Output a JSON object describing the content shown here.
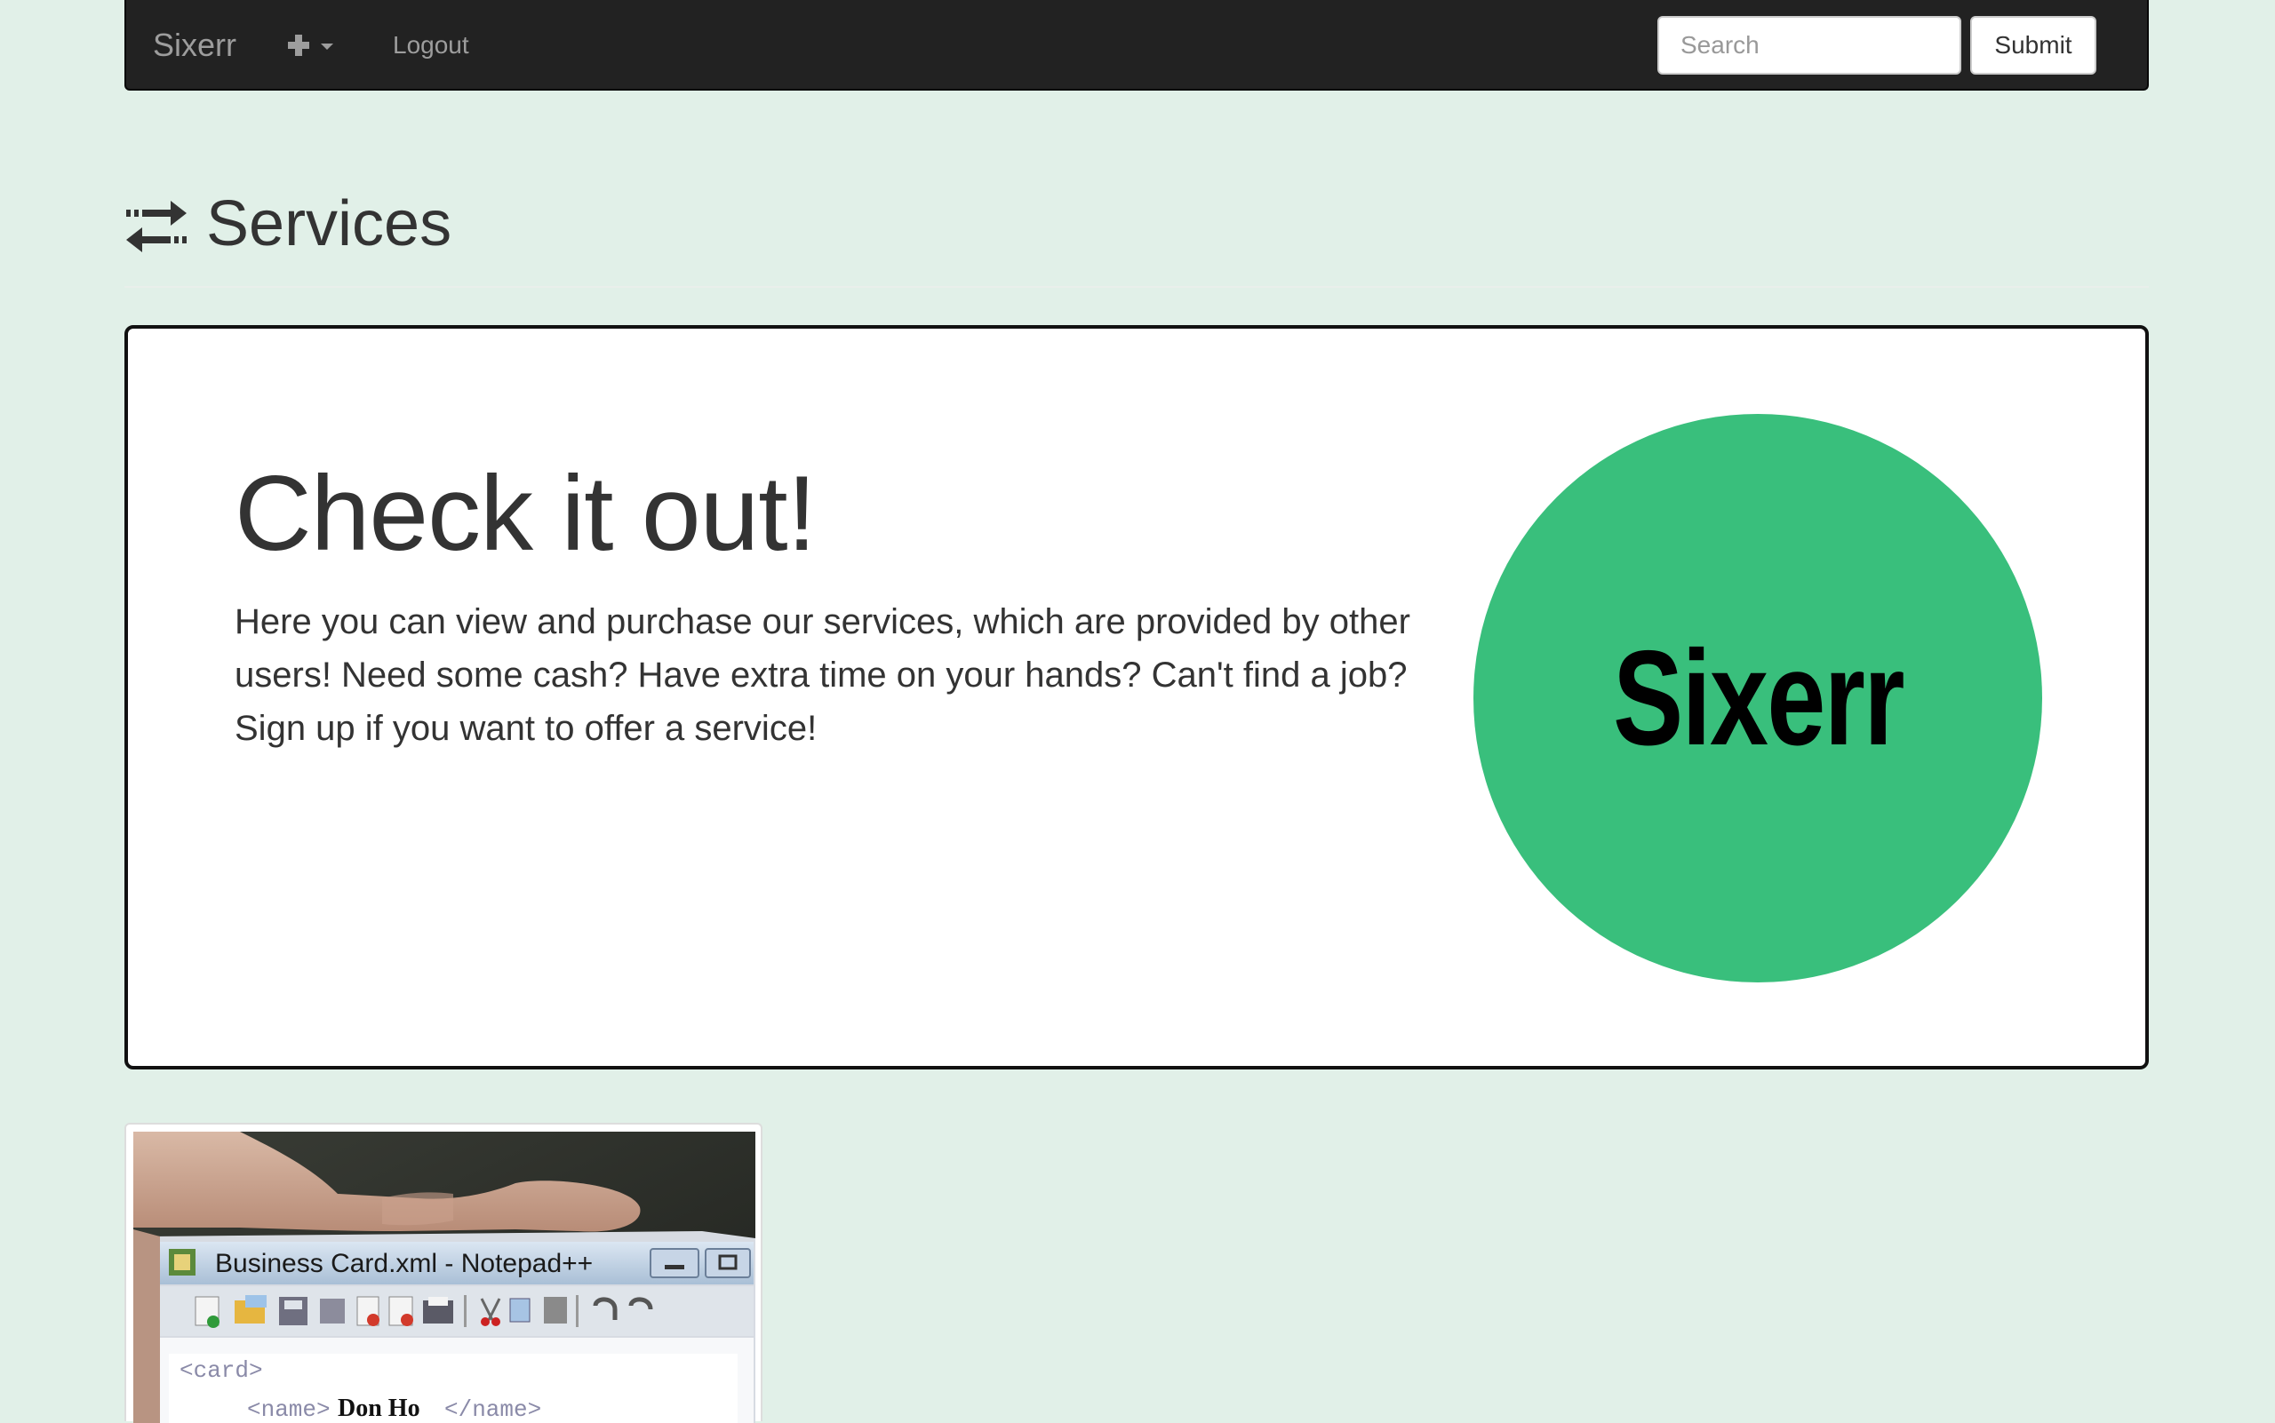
{
  "navbar": {
    "brand": "Sixerr",
    "plus_icon": "plus-icon",
    "caret_icon": "caret-down-icon",
    "logout_label": "Logout",
    "search_placeholder": "Search",
    "submit_label": "Submit"
  },
  "page_header": {
    "icon": "transfer-arrows-icon",
    "title": "Services"
  },
  "jumbotron": {
    "heading": "Check it out!",
    "text": "Here you can view and purchase our services, which are provided by other users! Need some cash? Have extra time on your hands? Can't find a job? Sign up if you want to offer a service!",
    "logo_text": "Sixerr",
    "logo_color": "#39bf7c"
  },
  "services": [
    {
      "thumbnail": {
        "window_title": "Business Card.xml - Notepad++",
        "code_line_1": "<card>",
        "code_tag_open": "<name>",
        "code_value": "Don  Ho",
        "code_tag_close": "</name>"
      }
    }
  ],
  "colors": {
    "background": "#e1f0e8",
    "navbar": "#222222",
    "accent": "#39bf7c"
  }
}
